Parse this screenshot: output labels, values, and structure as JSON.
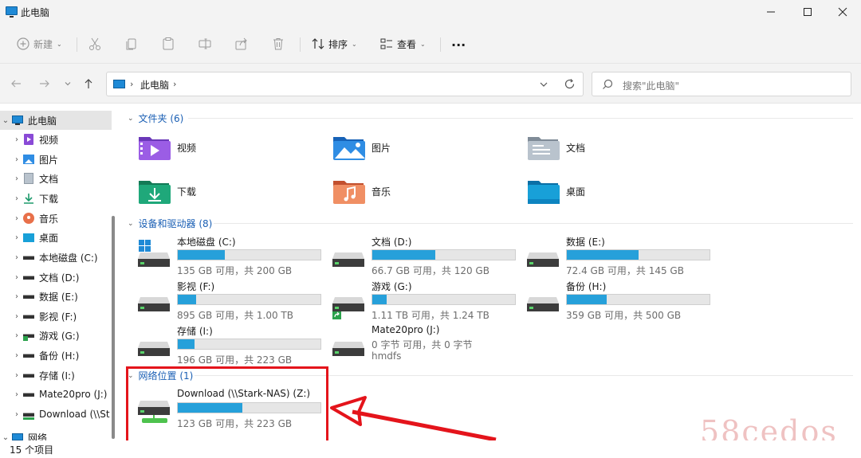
{
  "window": {
    "title": "此电脑"
  },
  "toolbar": {
    "new_label": "新建",
    "sort_label": "排序",
    "view_label": "查看",
    "more_label": "..."
  },
  "address": {
    "crumb": "此电脑",
    "search_placeholder": "搜索\"此电脑\""
  },
  "sidebar": {
    "items": [
      {
        "label": "此电脑",
        "icon": "pc-icon"
      },
      {
        "label": "视频",
        "icon": "video-folder-icon"
      },
      {
        "label": "图片",
        "icon": "pictures-folder-icon"
      },
      {
        "label": "文档",
        "icon": "documents-folder-icon"
      },
      {
        "label": "下载",
        "icon": "downloads-icon"
      },
      {
        "label": "音乐",
        "icon": "music-icon"
      },
      {
        "label": "桌面",
        "icon": "desktop-folder-icon"
      },
      {
        "label": "本地磁盘 (C:)",
        "icon": "drive-icon"
      },
      {
        "label": "文档 (D:)",
        "icon": "drive-icon"
      },
      {
        "label": "数据 (E:)",
        "icon": "drive-icon"
      },
      {
        "label": "影视 (F:)",
        "icon": "drive-icon"
      },
      {
        "label": "游戏 (G:)",
        "icon": "drive-icon"
      },
      {
        "label": "备份 (H:)",
        "icon": "drive-icon"
      },
      {
        "label": "存储 (I:)",
        "icon": "drive-icon"
      },
      {
        "label": "Mate20pro (J:)",
        "icon": "drive-icon"
      },
      {
        "label": "Download (\\\\St",
        "icon": "network-drive-icon"
      },
      {
        "label": "网络",
        "icon": "network-icon"
      }
    ]
  },
  "groups": {
    "folders_header": "文件夹 (6)",
    "devices_header": "设备和驱动器 (8)",
    "network_header": "网络位置 (1)"
  },
  "folders": [
    {
      "name": "视频"
    },
    {
      "name": "图片"
    },
    {
      "name": "文档"
    },
    {
      "name": "下载"
    },
    {
      "name": "音乐"
    },
    {
      "name": "桌面"
    }
  ],
  "drives": [
    {
      "name": "本地磁盘 (C:)",
      "free": "135 GB 可用，共 200 GB",
      "used_fraction": 0.33
    },
    {
      "name": "文档 (D:)",
      "free": "66.7 GB 可用，共 120 GB",
      "used_fraction": 0.44
    },
    {
      "name": "数据 (E:)",
      "free": "72.4 GB 可用，共 145 GB",
      "used_fraction": 0.5
    },
    {
      "name": "影视 (F:)",
      "free": "895 GB 可用，共 1.00 TB",
      "used_fraction": 0.13
    },
    {
      "name": "游戏 (G:)",
      "free": "1.11 TB 可用，共 1.24 TB",
      "used_fraction": 0.1
    },
    {
      "name": "备份 (H:)",
      "free": "359 GB 可用，共 500 GB",
      "used_fraction": 0.28
    },
    {
      "name": "存储 (I:)",
      "free": "196 GB 可用，共 223 GB",
      "used_fraction": 0.12
    },
    {
      "name": "Mate20pro (J:)",
      "free": "0 字节 可用，共 0 字节",
      "sub": "hmdfs",
      "used_fraction": null
    }
  ],
  "network_drive": {
    "name": "Download (\\\\Stark-NAS) (Z:)",
    "free": "123 GB 可用，共 223 GB",
    "used_fraction": 0.45
  },
  "status": {
    "count": "15 个项目"
  },
  "watermark": "58cedos",
  "colors": {
    "accent": "#26a0da",
    "highlight": "#e4141b",
    "link": "#1a5fb4"
  }
}
